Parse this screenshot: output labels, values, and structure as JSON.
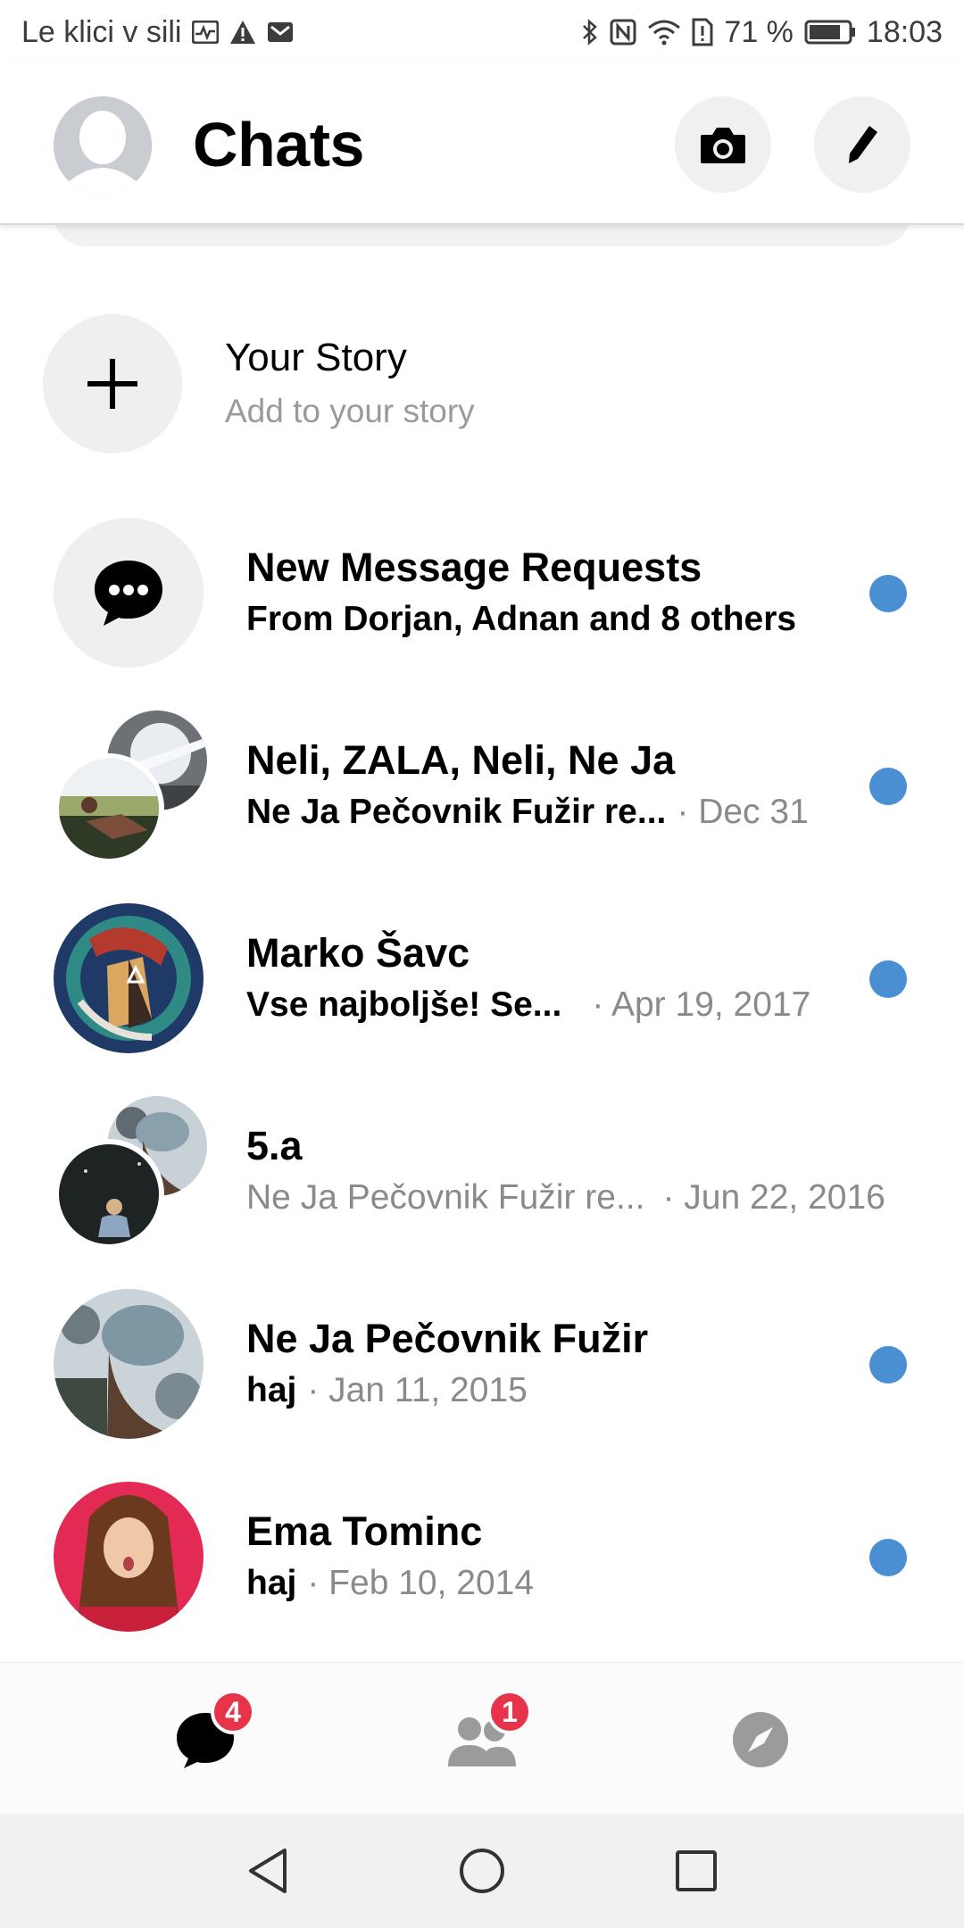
{
  "status_bar": {
    "carrier": "Le klici v sili",
    "battery": "71 %",
    "time": "18:03"
  },
  "header": {
    "title": "Chats",
    "profile_icon": "profile-avatar-placeholder",
    "camera_icon": "camera-icon",
    "compose_icon": "pencil-icon"
  },
  "story": {
    "title": "Your Story",
    "subtitle": "Add to your story"
  },
  "chats": [
    {
      "name": "New Message Requests",
      "snippet": "From Dorjan, Adnan and 8 others",
      "time": "",
      "unread": true,
      "avatar": "message-requests-icon"
    },
    {
      "name": "Neli, ZALA, Neli, Ne Ja",
      "snippet": "Ne Ja Pečovnik Fužir re...",
      "time": "· Dec 31",
      "unread": true,
      "avatar": "group-photo"
    },
    {
      "name": "Marko Šavc",
      "snippet": "Vse najboljše! Se...",
      "time": "· Apr 19, 2017",
      "unread": true,
      "avatar": "artwork-photo"
    },
    {
      "name": "5.a",
      "snippet": "Ne Ja Pečovnik Fužir re...",
      "time": "· Jun 22, 2016",
      "unread": false,
      "avatar": "group-photo"
    },
    {
      "name": "Ne Ja Pečovnik Fužir",
      "snippet": "haj",
      "time": "· Jan 11, 2015",
      "unread": true,
      "avatar": "portrait-photo"
    },
    {
      "name": "Ema Tominc",
      "snippet": "haj",
      "time": "· Feb 10, 2014",
      "unread": true,
      "avatar": "portrait-photo"
    }
  ],
  "bottom_nav": {
    "chats_badge": "4",
    "people_badge": "1"
  },
  "colors": {
    "unread_dot": "#4a8fd1",
    "badge": "#e8344a"
  }
}
